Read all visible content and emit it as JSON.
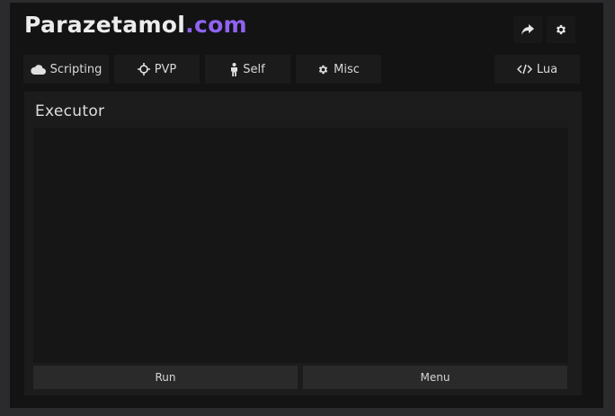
{
  "header": {
    "title_main": "Parazetamol",
    "title_accent": ".com",
    "accent_color": "#8f63f2",
    "share_icon": "share-arrow-icon",
    "settings_icon": "gear-icon"
  },
  "tabs": [
    {
      "label": "Scripting",
      "icon": "cloud-icon"
    },
    {
      "label": "PVP",
      "icon": "crosshair-icon"
    },
    {
      "label": "Self",
      "icon": "person-icon"
    },
    {
      "label": "Misc",
      "icon": "gear-icon"
    },
    {
      "label": "Lua",
      "icon": "code-icon"
    }
  ],
  "executor": {
    "title": "Executor",
    "editor_value": "",
    "run_label": "Run",
    "menu_label": "Menu"
  }
}
